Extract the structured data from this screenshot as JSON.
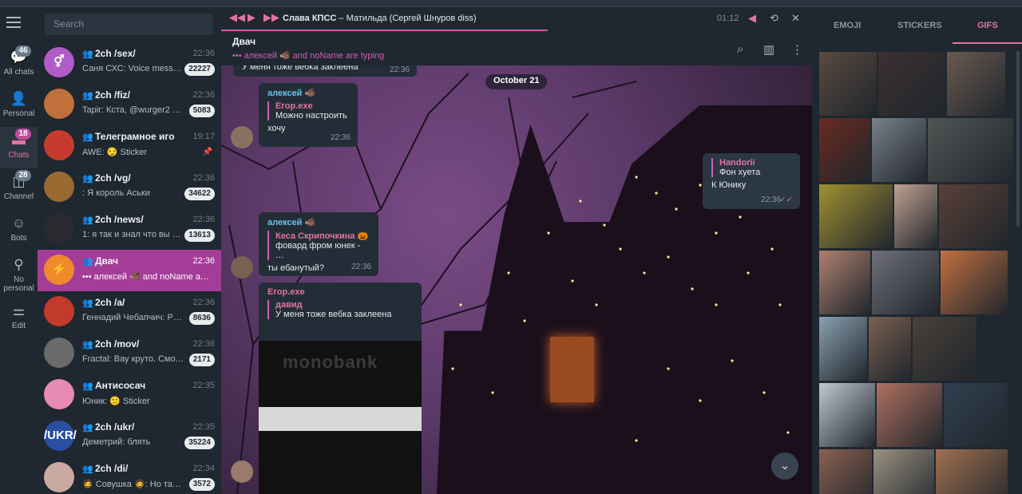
{
  "folders": [
    {
      "label": "All chats",
      "badge": "46",
      "icon": "chat-bubble-icon"
    },
    {
      "label": "Personal",
      "badge": "",
      "icon": "person-icon"
    },
    {
      "label": "Chats",
      "badge": "18",
      "icon": "folder-icon"
    },
    {
      "label": "Channel",
      "badge": "28",
      "icon": "megaphone-icon"
    },
    {
      "label": "Bots",
      "badge": "",
      "icon": "bot-icon"
    },
    {
      "label": "No personal",
      "badge": "",
      "icon": "no-person-icon"
    },
    {
      "label": "Edit",
      "badge": "",
      "icon": "edit-sliders-icon"
    }
  ],
  "search": {
    "placeholder": "Search"
  },
  "chats": [
    {
      "title": "2ch /sex/",
      "time": "22:36",
      "preview": "Саня СХС: Voice mess…",
      "badge": "22227",
      "avatar_color": "#b05cc8",
      "avatar_text": "⚥"
    },
    {
      "title": "2ch /fiz/",
      "time": "22:36",
      "preview": "Tapir: Кста, @wurger2 т…",
      "badge": "5083",
      "avatar_color": "#c0703a",
      "avatar_text": ""
    },
    {
      "title": "Телеграмное иго",
      "time": "19:17",
      "preview": "AWE: 😏 Sticker",
      "badge": "",
      "avatar_color": "#c73b2e",
      "avatar_text": ""
    },
    {
      "title": "2ch /vg/",
      "time": "22:36",
      "preview": ": Я король Аськи",
      "badge": "34622",
      "avatar_color": "#9a6a30",
      "avatar_text": ""
    },
    {
      "title": "2ch /news/",
      "time": "22:36",
      "preview": "1: я так и знал что вы …",
      "badge": "13613",
      "avatar_color": "#2a2a30",
      "avatar_text": ""
    },
    {
      "title": "Двач",
      "time": "22:36",
      "preview": "••• алексей 🐗 and noName a…",
      "badge": "",
      "avatar_color": "#f08a2c",
      "avatar_text": "⚡"
    },
    {
      "title": "2ch /a/",
      "time": "22:36",
      "preview": "Геннадий Чебапчич: Р…",
      "badge": "8636",
      "avatar_color": "#c23a2a",
      "avatar_text": ""
    },
    {
      "title": "2ch /mov/",
      "time": "22:36",
      "preview": "Fractal: Вау круто. Смот…",
      "badge": "2171",
      "avatar_color": "#6a6a6a",
      "avatar_text": ""
    },
    {
      "title": "Антисосач",
      "time": "22:35",
      "preview": "Юник: 🙂 Sticker",
      "badge": "",
      "avatar_color": "#e78ab5",
      "avatar_text": ""
    },
    {
      "title": "2ch /ukr/",
      "time": "22:35",
      "preview": "Деметрий: блять",
      "badge": "35224",
      "avatar_color": "#2a4fa0",
      "avatar_text": "/UKR/"
    },
    {
      "title": "2ch /di/",
      "time": "22:34",
      "preview": "🧔 Совушка 🧔: Но там…",
      "badge": "3572",
      "avatar_color": "#c9a9a0",
      "avatar_text": ""
    }
  ],
  "player": {
    "track": "Слава КПСС",
    "sep": " – ",
    "subtitle": "Матильда (Сергей Шнуров diss)",
    "time": "01:12"
  },
  "header": {
    "name": "Двач",
    "typing": "••• алексей 🐗 and noName are typing"
  },
  "messages": {
    "top_text": "У меня тоже вебка заклеена",
    "top_time": "22:36",
    "date": "October 21",
    "m1": {
      "sender": "алексей 🐗",
      "quote_name": "Eгор.exe",
      "quote_text": "Можно настроить",
      "text": "хочу",
      "time": "22:36"
    },
    "m2": {
      "quote_name": "Handorii",
      "quote_text": "Фон хуета",
      "text": "К Юнику",
      "time": "22:36",
      "check": "✓✓"
    },
    "m3": {
      "sender": "алексей 🐗",
      "quote_name": "Кеса Скрипочкина 🎃",
      "quote_text": "фовард фром юнек  - …",
      "text": "ты ебанутый?",
      "time": "22:36"
    },
    "m4": {
      "sender": "Eгор.exe",
      "quote_name": "давид",
      "quote_text": "У меня тоже вебка заклеена",
      "media_text": "monobank"
    }
  },
  "panel": {
    "tabs": [
      "EMOJI",
      "STICKERS",
      "GIFS"
    ],
    "active_tab": "GIFS"
  },
  "colors": {
    "accent": "#e0759f",
    "active_chat": "#a43d97",
    "sidebar": "#1f2730"
  }
}
